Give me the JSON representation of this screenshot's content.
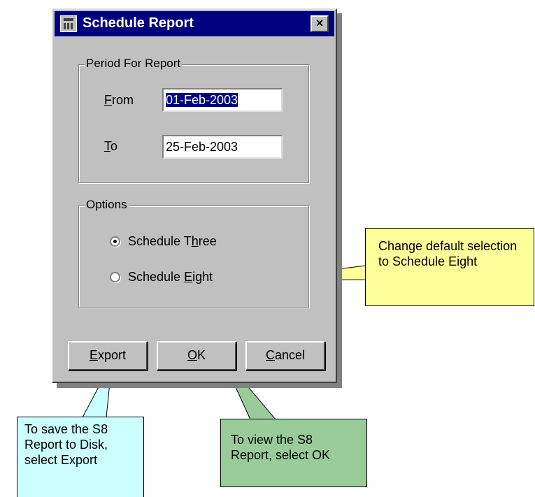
{
  "window": {
    "title": "Schedule Report",
    "close_glyph": "×"
  },
  "period_group": {
    "label": "Period For Report",
    "from_label_accel": "F",
    "from_label_rest": "rom",
    "from_value": "01-Feb-2003",
    "to_label_accel": "T",
    "to_label_rest": "o",
    "to_value": "25-Feb-2003"
  },
  "options_group": {
    "label": "Options",
    "option1_pre": "Schedule T",
    "option1_accel": "h",
    "option1_post": "ree",
    "option1_checked": true,
    "option2_pre": "Schedule ",
    "option2_accel": "E",
    "option2_post": "ight",
    "option2_checked": false
  },
  "buttons": {
    "export_accel": "E",
    "export_rest": "xport",
    "ok_accel": "O",
    "ok_rest": "K",
    "cancel_accel": "C",
    "cancel_rest": "ancel"
  },
  "callouts": {
    "default_selection": "Change default selection to Schedule Eight",
    "export_help": "To save the S8 Report to Disk, select Export",
    "ok_help": "To view the S8 Report, select OK"
  },
  "colors": {
    "dialog_face": "#c0c0c0",
    "title_bar": "#000080",
    "callout_yellow": "#ffff99",
    "callout_cyan": "#ccffff",
    "callout_green": "#99cc99"
  },
  "icons": {
    "app": "app-window-icon",
    "close": "close-icon"
  }
}
